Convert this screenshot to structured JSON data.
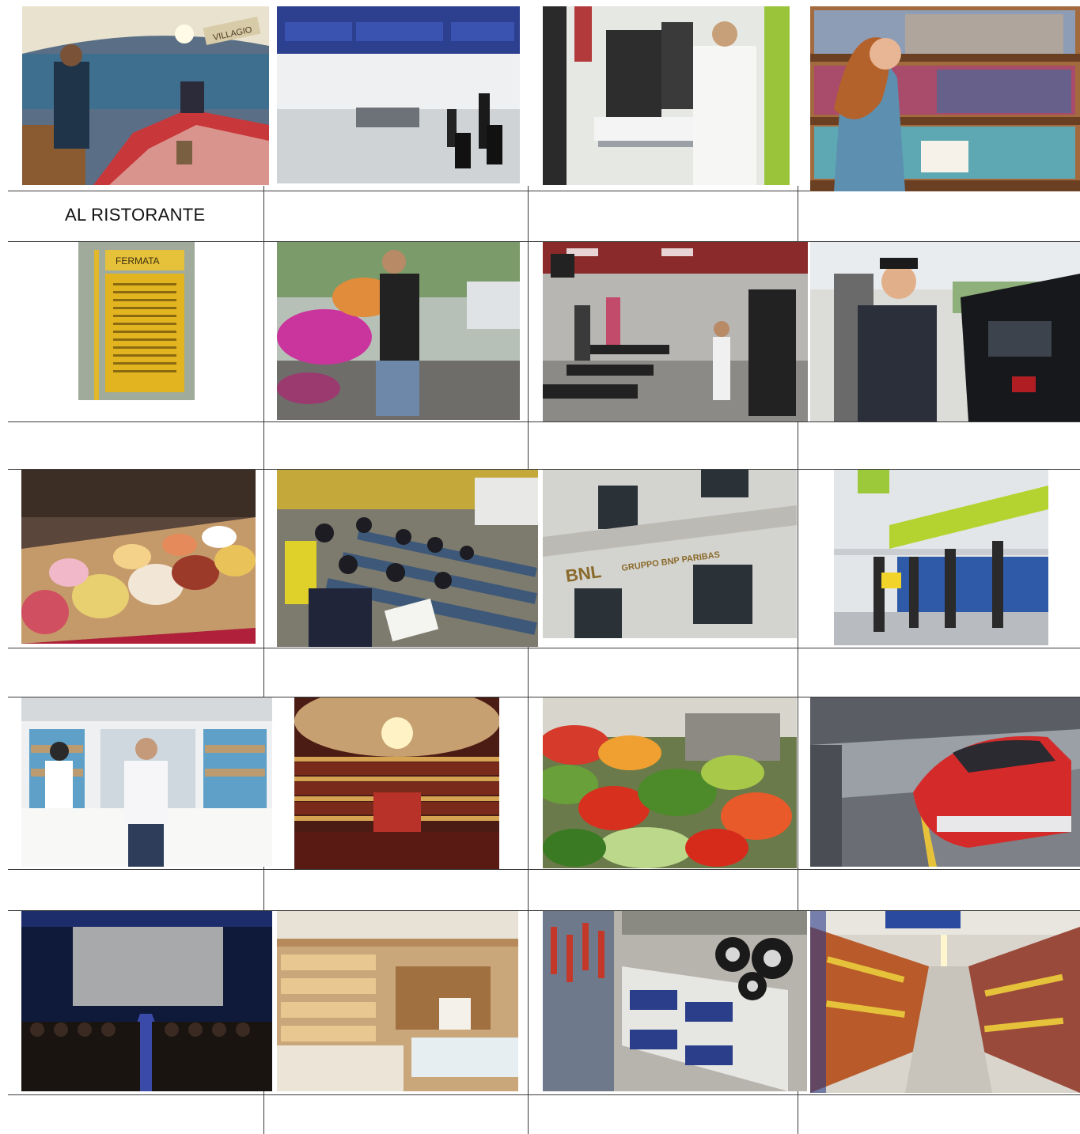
{
  "worksheet": {
    "photos": [
      {
        "icon": "restaurant-photo"
      },
      {
        "icon": "airport-photo"
      },
      {
        "icon": "hospital-photo"
      },
      {
        "icon": "library-photo"
      },
      {
        "icon": "bus-stop-photo"
      },
      {
        "icon": "florist-photo"
      },
      {
        "icon": "gym-photo"
      },
      {
        "icon": "gas-station-photo"
      },
      {
        "icon": "ice-cream-shop-photo"
      },
      {
        "icon": "university-lecture-hall-photo"
      },
      {
        "icon": "bank-photo"
      },
      {
        "icon": "post-office-photo"
      },
      {
        "icon": "pharmacy-photo"
      },
      {
        "icon": "theater-photo"
      },
      {
        "icon": "market-photo"
      },
      {
        "icon": "train-station-photo"
      },
      {
        "icon": "cinema-photo"
      },
      {
        "icon": "grocery-shop-photo"
      },
      {
        "icon": "hardware-store-photo"
      },
      {
        "icon": "supermarket-photo"
      }
    ],
    "captions": [
      "AL RISTORANTE",
      "",
      "",
      "",
      "",
      "",
      "",
      "",
      "",
      "",
      "",
      "",
      "",
      "",
      "",
      "",
      "",
      "",
      "",
      ""
    ],
    "sign_texts": {
      "bus_stop_sign": "FERMATA",
      "bank_sign": "BNL",
      "bank_group": "GRUPPO BNP PARIBAS",
      "restaurant_awning": "VILLAGIO"
    }
  }
}
